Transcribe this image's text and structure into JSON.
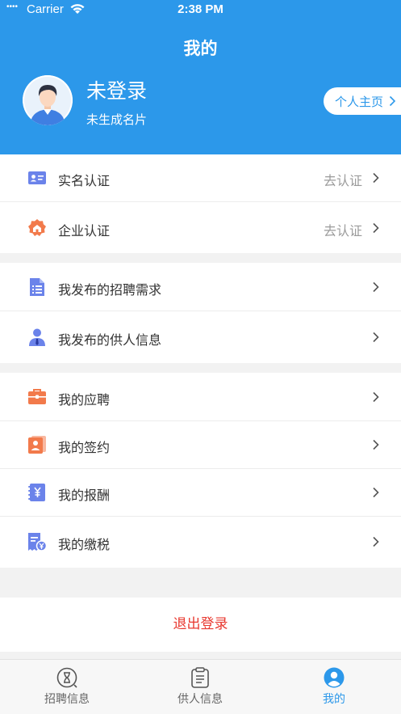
{
  "status_bar": {
    "signal": "••••",
    "carrier": "Carrier",
    "time": "2:38 PM"
  },
  "header": {
    "title": "我的",
    "user_name": "未登录",
    "user_sub": "未生成名片",
    "home_button": "个人主页"
  },
  "sections": {
    "auth": [
      {
        "label": "实名认证",
        "action": "去认证",
        "icon": "id-card-icon"
      },
      {
        "label": "企业认证",
        "action": "去认证",
        "icon": "enterprise-badge-icon"
      }
    ],
    "publish": [
      {
        "label": "我发布的招聘需求",
        "icon": "document-icon"
      },
      {
        "label": "我发布的供人信息",
        "icon": "person-icon"
      }
    ],
    "mine": [
      {
        "label": "我的应聘",
        "icon": "briefcase-icon"
      },
      {
        "label": "我的签约",
        "icon": "contract-icon"
      },
      {
        "label": "我的报酬",
        "icon": "payment-icon"
      },
      {
        "label": "我的缴税",
        "icon": "tax-receipt-icon"
      }
    ]
  },
  "logout_label": "退出登录",
  "tabbar": [
    {
      "label": "招聘信息",
      "icon": "recruit-icon",
      "active": false
    },
    {
      "label": "供人信息",
      "icon": "clipboard-icon",
      "active": false
    },
    {
      "label": "我的",
      "icon": "profile-icon",
      "active": true
    }
  ],
  "colors": {
    "primary": "#2c98ea",
    "logout": "#e8382f",
    "icon_blue": "#5d7de8",
    "icon_orange": "#f27a4b"
  }
}
